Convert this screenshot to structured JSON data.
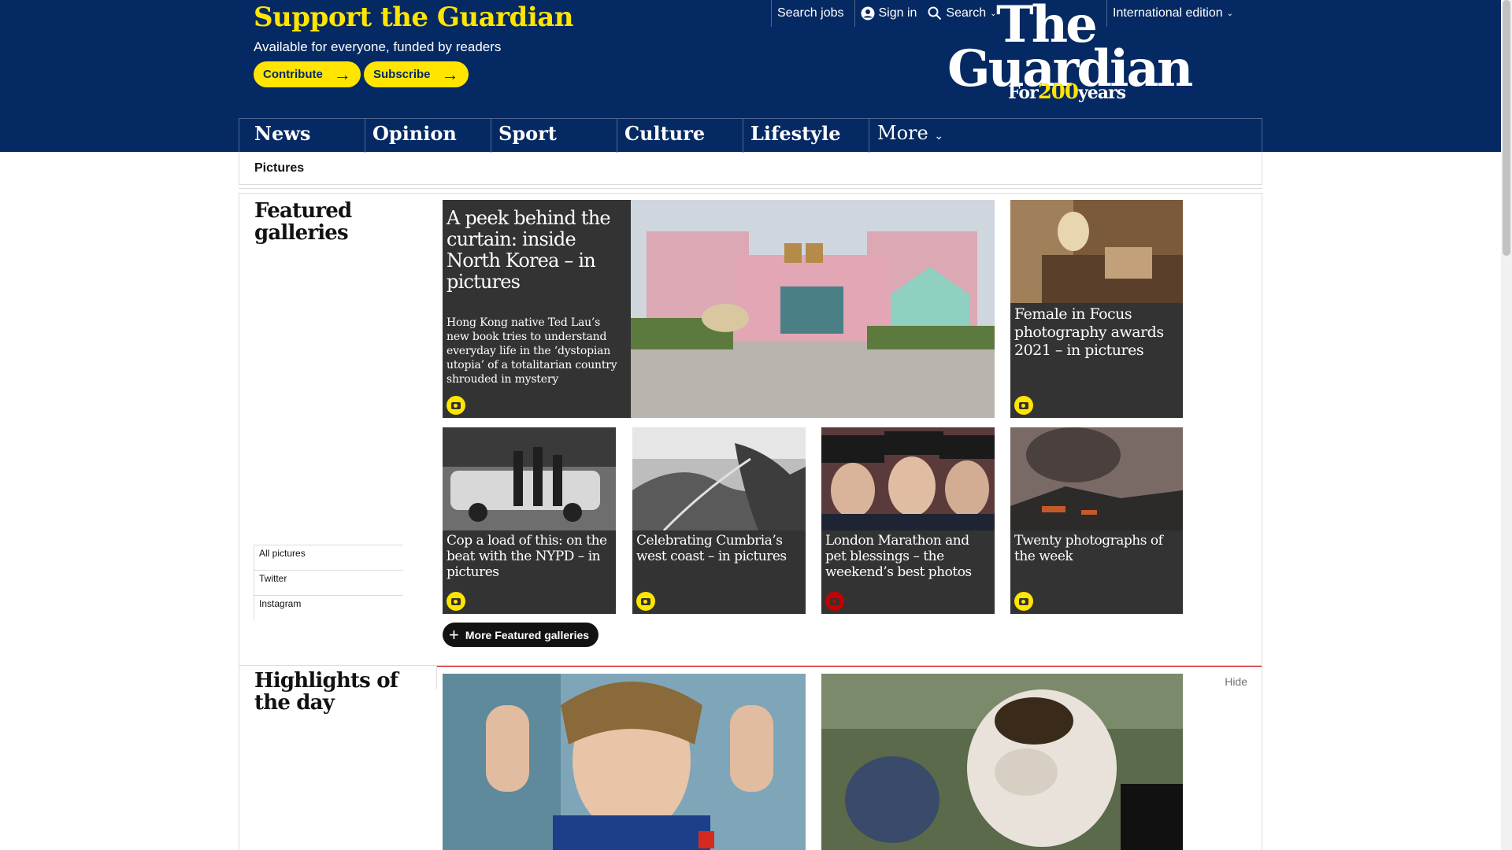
{
  "support": {
    "title": "Support the Guardian",
    "subtitle": "Available for everyone, funded by readers",
    "contribute": "Contribute",
    "subscribe": "Subscribe"
  },
  "top_links": {
    "search_jobs": "Search jobs",
    "sign_in": "Sign in",
    "search": "Search",
    "edition": "International edition"
  },
  "logo": {
    "line1": "The",
    "line2": "Guardian",
    "for": "For",
    "years_num": "200",
    "years": "years"
  },
  "nav": {
    "items": [
      "News",
      "Opinion",
      "Sport",
      "Culture",
      "Lifestyle"
    ],
    "more": "More"
  },
  "subnav": {
    "current": "Pictures"
  },
  "featured": {
    "title": "Featured galleries",
    "main": {
      "headline": "A peek behind the curtain: inside North Korea – in pictures",
      "standfirst": "Hong Kong native Ted Lau’s new book tries to understand everyday life in the ‘dystopian utopia’ of a totalitarian country shrouded in mystery"
    },
    "side": {
      "headline": "Female in Focus photography awards 2021 – in pictures"
    },
    "row": [
      {
        "headline": "Cop a load of this: on the beat with the NYPD – in pictures"
      },
      {
        "headline": "Celebrating Cumbria’s west coast – in pictures"
      },
      {
        "headline": "London Marathon and pet blessings – the weekend’s best photos"
      },
      {
        "headline": "Twenty photographs of the week"
      }
    ],
    "more_button": "More Featured galleries",
    "links": [
      "All pictures",
      "Twitter",
      "Instagram"
    ]
  },
  "highlights": {
    "title": "Highlights of the day",
    "hide": "Hide"
  },
  "colors": {
    "brand": "#052962",
    "accent": "#ffe500",
    "card": "#333333",
    "live": "#c70000"
  }
}
